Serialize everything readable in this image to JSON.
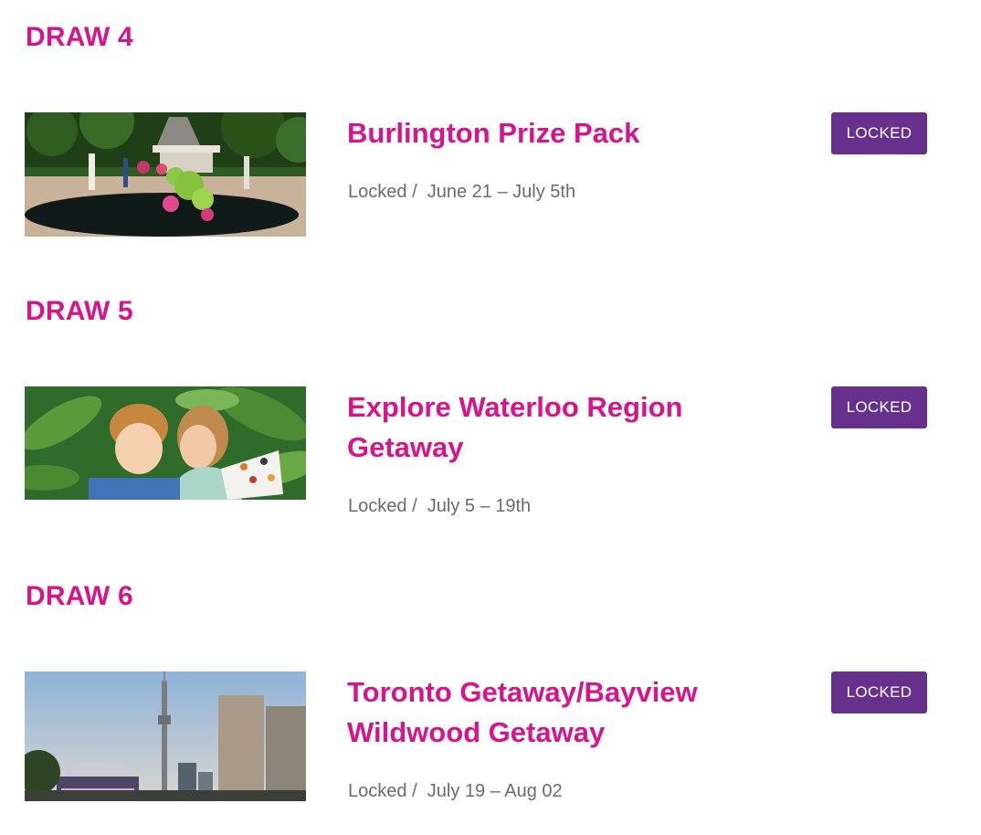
{
  "draws": [
    {
      "heading": "DRAW 4",
      "title": "Burlington Prize Pack",
      "status": "Locked",
      "separator": "/",
      "dates": "June 21 – July 5th",
      "button_label": "LOCKED",
      "image_icon": "garden-pond-photo"
    },
    {
      "heading": "DRAW 5",
      "title": "Explore Waterloo Region Getaway",
      "status": "Locked",
      "separator": "/",
      "dates": "July 5 – 19th",
      "button_label": "LOCKED",
      "image_icon": "children-butterflies-photo"
    },
    {
      "heading": "DRAW 6",
      "title": "Toronto Getaway/Bayview Wildwood Getaway",
      "status": "Locked",
      "separator": "/",
      "dates": "July 19 – Aug 02",
      "button_label": "LOCKED",
      "image_icon": "toronto-skyline-photo"
    }
  ],
  "colors": {
    "heading": "#d6148c",
    "button_bg": "#66308c",
    "meta_text": "#6b6b6b"
  }
}
